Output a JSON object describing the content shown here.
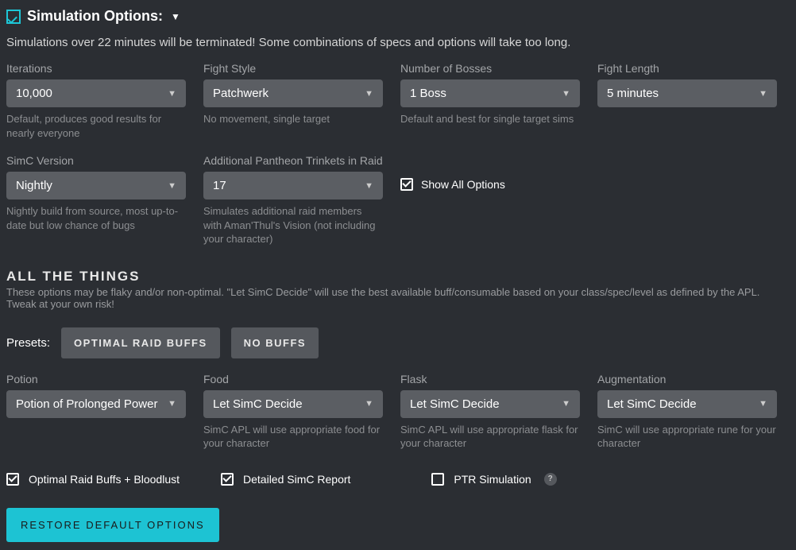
{
  "header": {
    "title": "Simulation Options:",
    "warning": "Simulations over 22 minutes will be terminated! Some combinations of specs and options will take too long."
  },
  "row1": {
    "iterations": {
      "label": "Iterations",
      "value": "10,000",
      "helper": "Default, produces good results for nearly everyone"
    },
    "fightStyle": {
      "label": "Fight Style",
      "value": "Patchwerk",
      "helper": "No movement, single target"
    },
    "numBosses": {
      "label": "Number of Bosses",
      "value": "1 Boss",
      "helper": "Default and best for single target sims"
    },
    "fightLength": {
      "label": "Fight Length",
      "value": "5 minutes",
      "helper": ""
    }
  },
  "row2": {
    "simc": {
      "label": "SimC Version",
      "value": "Nightly",
      "helper": "Nightly build from source, most up-to-date but low chance of bugs"
    },
    "pantheon": {
      "label": "Additional Pantheon Trinkets in Raid",
      "value": "17",
      "helper": "Simulates additional raid members with Aman'Thul's Vision (not including your character)"
    },
    "showAll": {
      "label": "Show All Options"
    }
  },
  "allThings": {
    "title": "ALL THE THINGS",
    "sub": "These options may be flaky and/or non-optimal. \"Let SimC Decide\" will use the best available buff/consumable based on your class/spec/level as defined by the APL. Tweak at your own risk!"
  },
  "presets": {
    "label": "Presets:",
    "optimal": "OPTIMAL RAID BUFFS",
    "nobuffs": "NO BUFFS"
  },
  "row3": {
    "potion": {
      "label": "Potion",
      "value": "Potion of Prolonged Power",
      "helper": ""
    },
    "food": {
      "label": "Food",
      "value": "Let SimC Decide",
      "helper": "SimC APL will use appropriate food for your character"
    },
    "flask": {
      "label": "Flask",
      "value": "Let SimC Decide",
      "helper": "SimC APL will use appropriate flask for your character"
    },
    "aug": {
      "label": "Augmentation",
      "value": "Let SimC Decide",
      "helper": "SimC will use appropriate rune for your character"
    }
  },
  "footerChecks": {
    "optimal": "Optimal Raid Buffs + Bloodlust",
    "detailed": "Detailed SimC Report",
    "ptr": "PTR Simulation"
  },
  "restore": "RESTORE DEFAULT OPTIONS"
}
